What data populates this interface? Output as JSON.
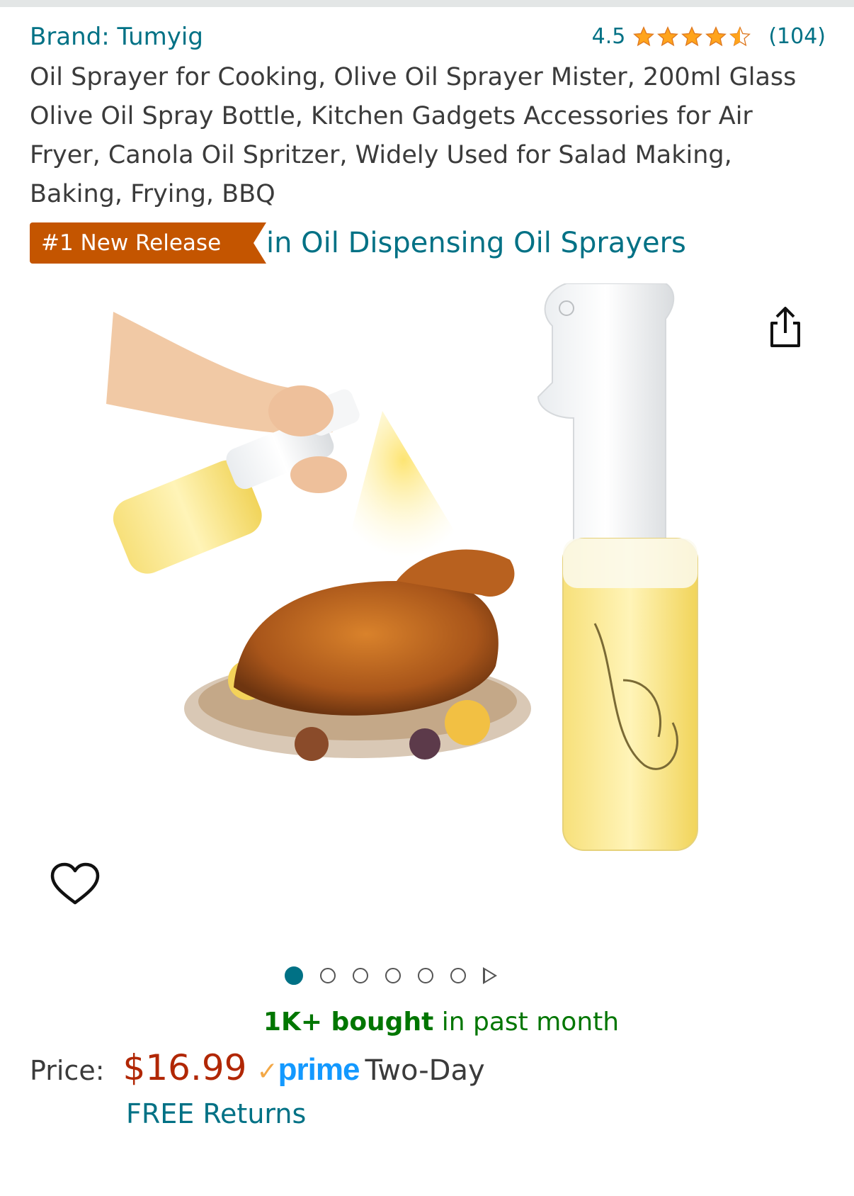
{
  "brand": {
    "label": "Brand: Tumyig"
  },
  "rating": {
    "value": "4.5",
    "stars": 4.5,
    "count": "(104)"
  },
  "product": {
    "title": "Oil Sprayer for Cooking, Olive Oil Sprayer Mister, 200ml Glass Olive Oil Spray Bottle, Kitchen Gadgets Accessories for Air Fryer, Canola Oil Spritzer, Widely Used for Salad Making, Baking, Frying, BBQ"
  },
  "badge": {
    "label": "#1 New Release",
    "category": "in Oil Dispensing Oil Sprayers"
  },
  "carousel": {
    "total_images": 6,
    "active_index": 0
  },
  "social_proof": {
    "bold": "1K+ bought",
    "rest": " in past month"
  },
  "price": {
    "label": "Price:",
    "value": "$16.99",
    "prime_check": "✓",
    "prime_word": "prime",
    "shipping": "Two-Day",
    "returns": "FREE Returns"
  },
  "colors": {
    "link": "#007185",
    "badge": "#c45500",
    "price": "#b12704",
    "star": "#ffa41c",
    "prime": "#1399ff",
    "bought": "#007600"
  },
  "icons": {
    "share": "share-icon",
    "wishlist": "heart-icon",
    "next": "play-icon"
  }
}
